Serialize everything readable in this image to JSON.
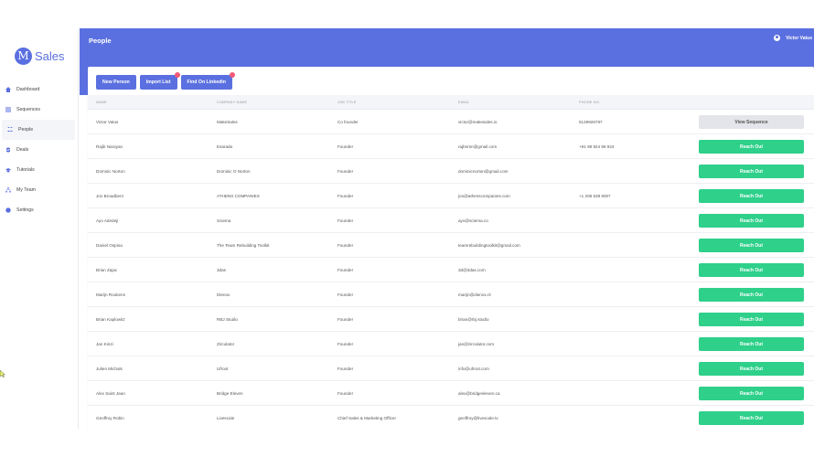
{
  "brand": {
    "logo_letter": "M",
    "name": "Sales"
  },
  "sidebar": {
    "items": [
      {
        "label": "Dashboard",
        "icon": "home-icon"
      },
      {
        "label": "Sequences",
        "icon": "list-icon"
      },
      {
        "label": "People",
        "icon": "users-icon",
        "active": true
      },
      {
        "label": "Deals",
        "icon": "dollar-icon"
      },
      {
        "label": "Tutorials",
        "icon": "graduation-cap-icon"
      },
      {
        "label": "My Team",
        "icon": "sitemap-icon"
      },
      {
        "label": "Settings",
        "icon": "gear-icon"
      }
    ]
  },
  "header": {
    "title": "People",
    "user_name": "Victor Vatus"
  },
  "toolbar": {
    "new_person": "New Person",
    "import_list": "Import List",
    "find_linkedin": "Find On LinkedIn"
  },
  "table": {
    "columns": [
      "NAME",
      "COMPANY NAME",
      "JOB TITLE",
      "EMAIL",
      "PHONE NO."
    ],
    "rows": [
      {
        "name": "Victor Vatus",
        "company": "MakeSales",
        "title": "Co founder",
        "email": "victor@makesales.io",
        "phone": "5149926787",
        "action": "View Sequence",
        "action_type": "view"
      },
      {
        "name": "Rajib Narayan",
        "company": "Esarada",
        "title": "Founder",
        "email": "rajbnrsn@gmail.com",
        "phone": "+91 98 924 98 924",
        "action": "Reach Out",
        "action_type": "reach"
      },
      {
        "name": "Dominic Norton",
        "company": "Dominic O Norton",
        "title": "Founder",
        "email": "dominicnorton@gmail.com",
        "phone": "",
        "action": "Reach Out",
        "action_type": "reach"
      },
      {
        "name": "Jon Broadbent",
        "company": "ATHENS COMPANIES",
        "title": "Founder",
        "email": "jon@athenscompanies.com",
        "phone": "+1 208 639 9007",
        "action": "Reach Out",
        "action_type": "reach"
      },
      {
        "name": "Ayo Adedeji",
        "company": "Sciema",
        "title": "Founder",
        "email": "ayo@sciema.co",
        "phone": "",
        "action": "Reach Out",
        "action_type": "reach"
      },
      {
        "name": "Daniel Ospina",
        "company": "The Team Rebuilding Toolkit",
        "title": "Founder",
        "email": "teamrebuildingtoolkit@gmail.com",
        "phone": "",
        "action": "Reach Out",
        "action_type": "reach"
      },
      {
        "name": "Brian Zajac",
        "company": "3das",
        "title": "Founder",
        "email": "3d@3das.com",
        "phone": "",
        "action": "Reach Out",
        "action_type": "reach"
      },
      {
        "name": "Marijn Roukens",
        "company": "Dienox",
        "title": "Founder",
        "email": "marijn@dienox.nl",
        "phone": "",
        "action": "Reach Out",
        "action_type": "reach"
      },
      {
        "name": "Brian Kaplowitz",
        "company": "RBJ Studio",
        "title": "Founder",
        "email": "brian@rbj.studio",
        "phone": "",
        "action": "Reach Out",
        "action_type": "reach"
      },
      {
        "name": "Jan Kinzi",
        "company": "Zirculator",
        "title": "Founder",
        "email": "jan@zirculator.com",
        "phone": "",
        "action": "Reach Out",
        "action_type": "reach"
      },
      {
        "name": "Julien Michals",
        "company": "Ufroot",
        "title": "Founder",
        "email": "info@ufroot.com",
        "phone": "",
        "action": "Reach Out",
        "action_type": "reach"
      },
      {
        "name": "Alex Saint Jean",
        "company": "Bridge Eleven",
        "title": "Founder",
        "email": "alex@bridgeeleven.ca",
        "phone": "",
        "action": "Reach Out",
        "action_type": "reach"
      },
      {
        "name": "Geoffroy Robin",
        "company": "Livescale",
        "title": "Chief Sales & Marketing Officer",
        "email": "geoffroy@livescale.tv",
        "phone": "",
        "action": "Reach Out",
        "action_type": "reach"
      }
    ]
  },
  "colors": {
    "primary": "#5b70e0",
    "success": "#2ed08a",
    "badge": "#f25b78",
    "neutral_button": "#e4e5ea"
  }
}
